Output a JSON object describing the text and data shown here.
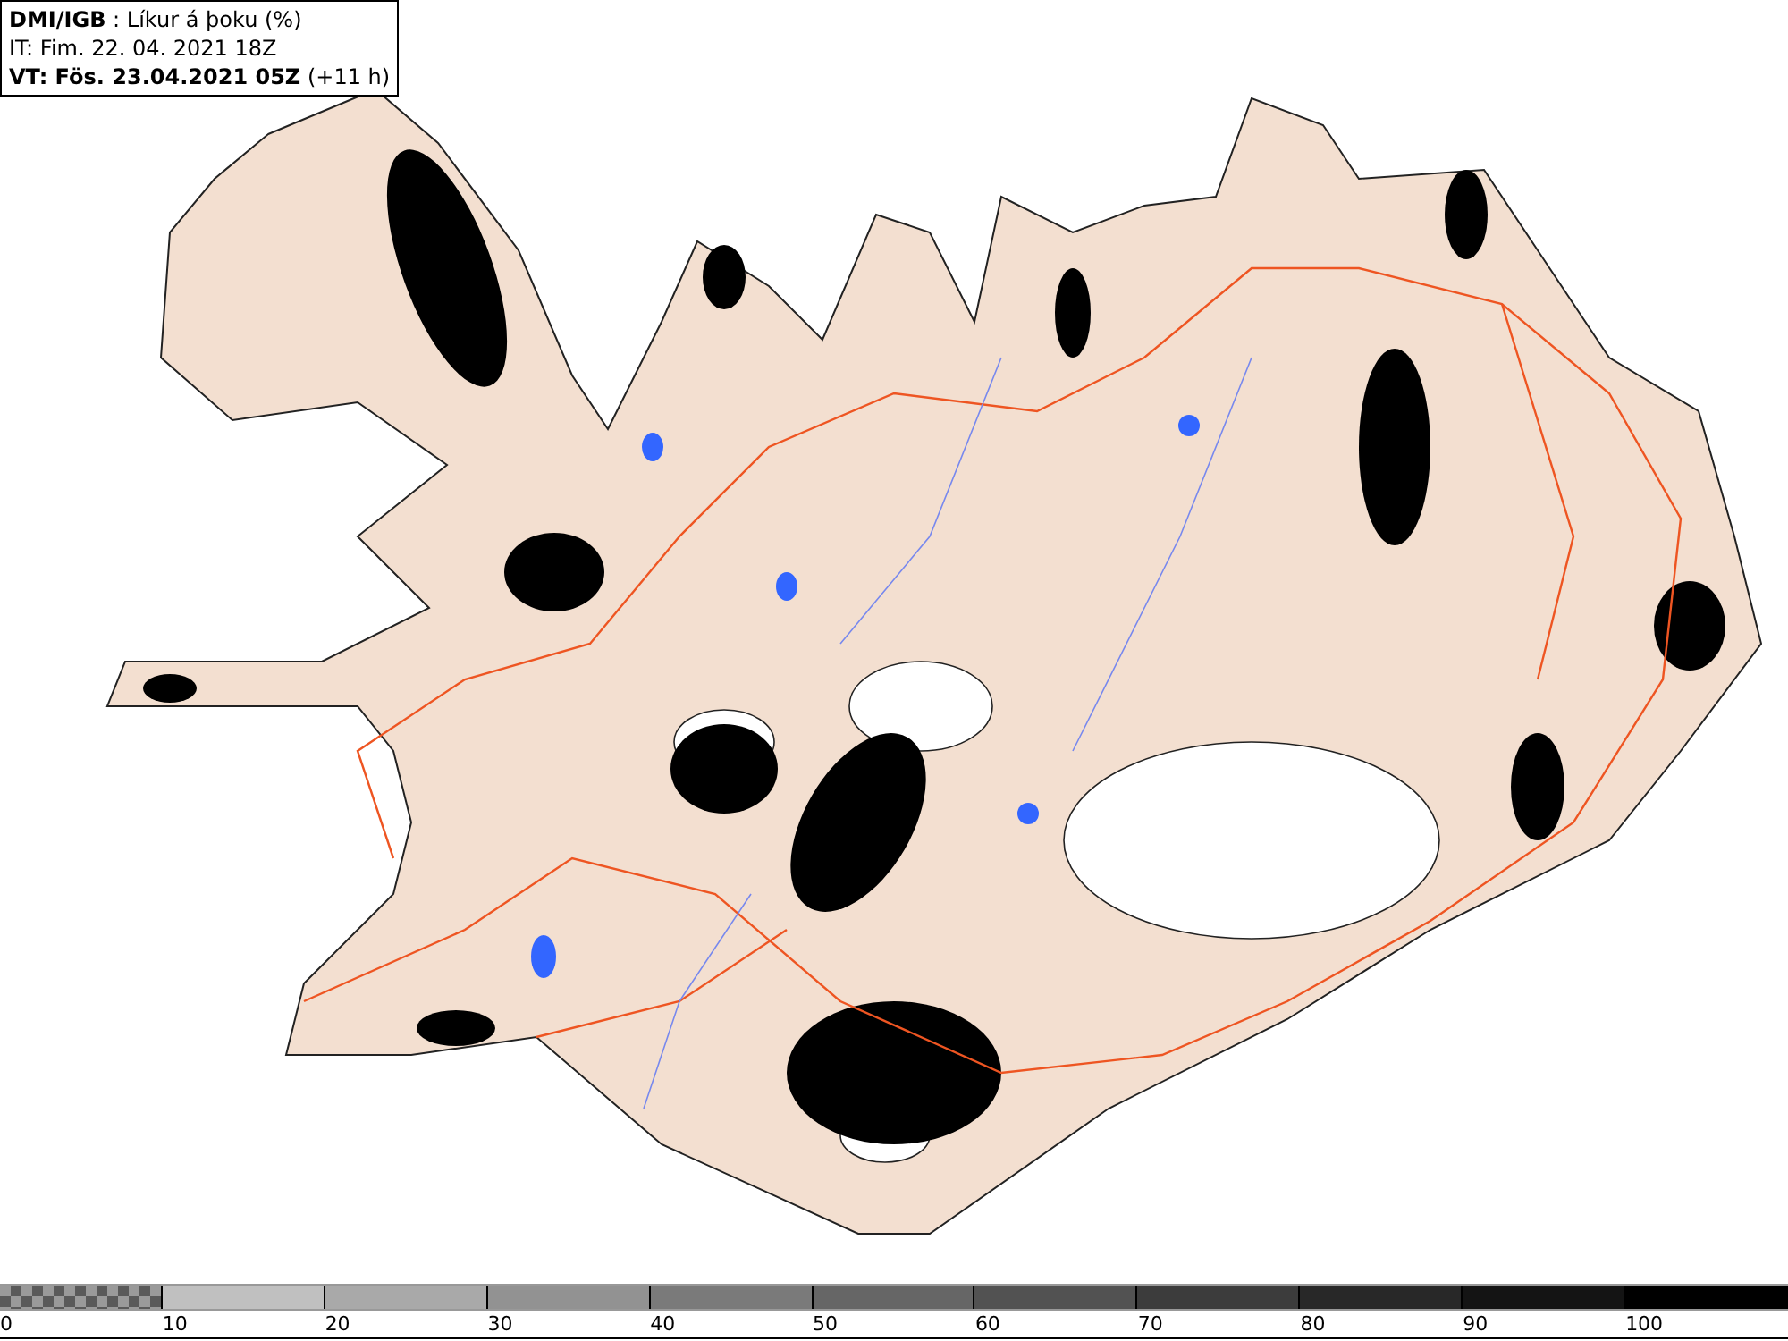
{
  "header": {
    "source": "DMI/IGB",
    "title": ": Líkur á þoku (%)",
    "issue_time": "IT: Fim. 22. 04. 2021 18Z",
    "valid_time": "VT: Fös. 23.04.2021 05Z",
    "lead_time": "(+11 h)"
  },
  "legend": [
    {
      "label": "0",
      "kind": "checker",
      "color": "#5a5a5a"
    },
    {
      "label": "10",
      "kind": "solid",
      "color": "#c0c0c0"
    },
    {
      "label": "20",
      "kind": "solid",
      "color": "#a9a9a9"
    },
    {
      "label": "30",
      "kind": "solid",
      "color": "#929292"
    },
    {
      "label": "40",
      "kind": "solid",
      "color": "#7a7a7a"
    },
    {
      "label": "50",
      "kind": "solid",
      "color": "#666666"
    },
    {
      "label": "60",
      "kind": "solid",
      "color": "#525252"
    },
    {
      "label": "70",
      "kind": "solid",
      "color": "#3c3c3c"
    },
    {
      "label": "80",
      "kind": "solid",
      "color": "#282828"
    },
    {
      "label": "90",
      "kind": "solid",
      "color": "#141414"
    },
    {
      "label": "100",
      "kind": "solid",
      "color": "#000000"
    }
  ]
}
